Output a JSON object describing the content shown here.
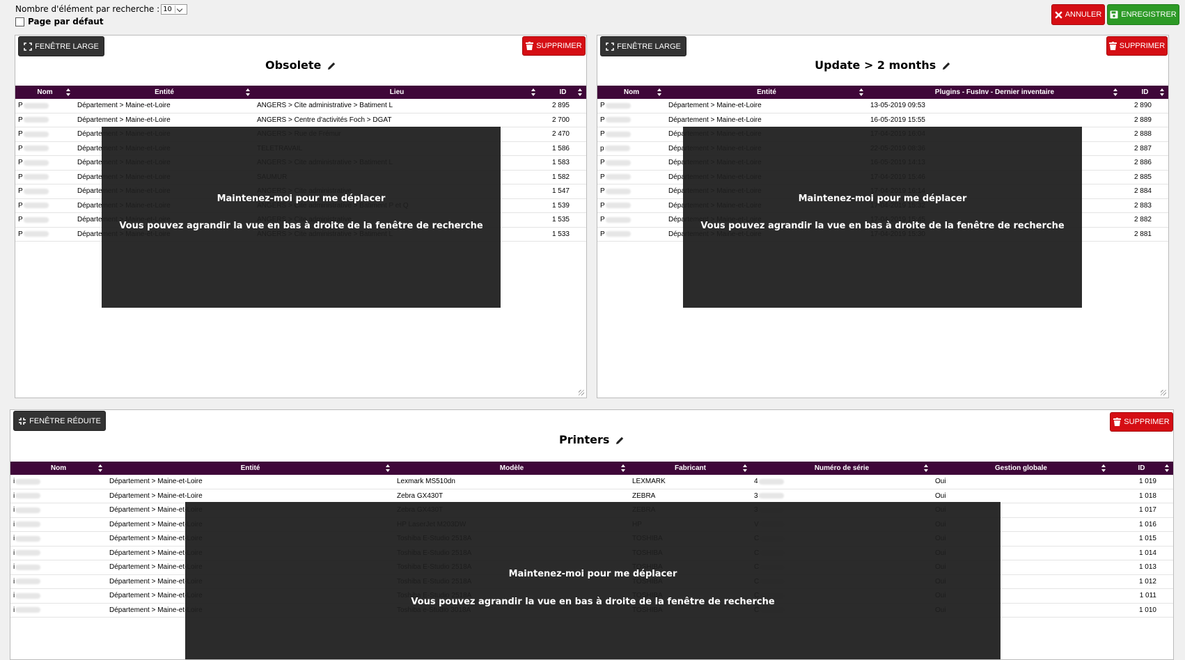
{
  "top": {
    "per_page_label": "Nombre d'élément par recherche :",
    "per_page_value": "10",
    "default_page_label": "Page par défaut",
    "cancel_label": "ANNULER",
    "save_label": "ENREGISTRER"
  },
  "overlay": {
    "line1": "Maintenez-moi pour me déplacer",
    "line2": "Vous pouvez agrandir la vue en bas à droite de la fenêtre de recherche"
  },
  "panels": {
    "obsolete": {
      "title": "Obsolete",
      "wide_label": "FENÊTRE LARGE",
      "delete_label": "SUPPRIMER",
      "columns": [
        "Nom",
        "Entité",
        "Lieu",
        "ID"
      ],
      "rows": [
        [
          "P",
          "Département > Maine-et-Loire",
          "ANGERS > Cite administrative > Batiment L",
          "2 895"
        ],
        [
          "P",
          "Département > Maine-et-Loire",
          "ANGERS > Centre d'activités Foch > DGAT",
          "2 700"
        ],
        [
          "P",
          "Département > Maine-et-Loire",
          "ANGERS > Rue de Frémur",
          "2 470"
        ],
        [
          "P",
          "Département > Maine-et-Loire",
          "TELETRAVAIL",
          "1 586"
        ],
        [
          "P",
          "Département > Maine-et-Loire",
          "ANGERS > Cite administrative > Batiment L",
          "1 583"
        ],
        [
          "P",
          "Département > Maine-et-Loire",
          "SAUMUR",
          "1 582"
        ],
        [
          "P",
          "Département > Maine-et-Loire",
          "ANGERS > Cite administrative",
          "1 547"
        ],
        [
          "P",
          "Département > Maine-et-Loire",
          "ANGERS > Cite administrative > Batiment P et Q",
          "1 539"
        ],
        [
          "P",
          "Département > Maine-et-Loire",
          "ANGERS > Cite administrative",
          "1 535"
        ],
        [
          "P",
          "Département > Maine-et-Loire",
          "ANGERS > Cite administrative > Batiment L",
          "1 533"
        ]
      ]
    },
    "update": {
      "title": "Update > 2 months",
      "wide_label": "FENÊTRE LARGE",
      "delete_label": "SUPPRIMER",
      "columns": [
        "Nom",
        "Entité",
        "Plugins - FusInv - Dernier inventaire",
        "ID"
      ],
      "rows": [
        [
          "P",
          "Département > Maine-et-Loire",
          "13-05-2019 09:53",
          "2 890"
        ],
        [
          "P",
          "Département > Maine-et-Loire",
          "16-05-2019 15:55",
          "2 889"
        ],
        [
          "P",
          "Département > Maine-et-Loire",
          "17-04-2019 16:04",
          "2 888"
        ],
        [
          "p",
          "Département > Maine-et-Loire",
          "22-05-2019 08:36",
          "2 887"
        ],
        [
          "P",
          "Département > Maine-et-Loire",
          "16-05-2019 14:13",
          "2 886"
        ],
        [
          "P",
          "Département > Maine-et-Loire",
          "17-04-2019 15:46",
          "2 885"
        ],
        [
          "P",
          "Département > Maine-et-Loire",
          "17-04-2019 16:14",
          "2 884"
        ],
        [
          "P",
          "Département > Maine-et-Loire",
          "17-04-2019 15:32",
          "2 883"
        ],
        [
          "P",
          "Département > Maine-et-Loire",
          "17-04-2019 15:45",
          "2 882"
        ],
        [
          "P",
          "Département > Maine-et-Loire",
          "17-04-2019 15:30",
          "2 881"
        ]
      ]
    },
    "printers": {
      "title": "Printers",
      "reduce_label": "FENÊTRE RÉDUITE",
      "delete_label": "SUPPRIMER",
      "columns": [
        "Nom",
        "Entité",
        "Modèle",
        "Fabricant",
        "Numéro de série",
        "Gestion globale",
        "ID"
      ],
      "rows": [
        [
          "i",
          "Département > Maine-et-Loire",
          "Lexmark MS510dn",
          "LEXMARK",
          "4",
          "Oui",
          "1 019"
        ],
        [
          "i",
          "Département > Maine-et-Loire",
          "Zebra GX430T",
          "ZEBRA",
          "3",
          "Oui",
          "1 018"
        ],
        [
          "i",
          "Département > Maine-et-Loire",
          "Zebra GX430T",
          "ZEBRA",
          "3",
          "Oui",
          "1 017"
        ],
        [
          "i",
          "Département > Maine-et-Loire",
          "HP LaserJet M203DW",
          "HP",
          "V",
          "Oui",
          "1 016"
        ],
        [
          "i",
          "Département > Maine-et-Loire",
          "Toshiba E-Studio 2518A",
          "TOSHIBA",
          "C",
          "Oui",
          "1 015"
        ],
        [
          "i",
          "Département > Maine-et-Loire",
          "Toshiba E-Studio 2518A",
          "TOSHIBA",
          "C",
          "Oui",
          "1 014"
        ],
        [
          "i",
          "Département > Maine-et-Loire",
          "Toshiba E-Studio 2518A",
          "TOSHIBA",
          "C",
          "Oui",
          "1 013"
        ],
        [
          "i",
          "Département > Maine-et-Loire",
          "Toshiba E-Studio 2518A",
          "TOSHIBA",
          "C",
          "Oui",
          "1 012"
        ],
        [
          "i",
          "Département > Maine-et-Loire",
          "Toshiba E-Studio 2518A",
          "TOSHIBA",
          "C",
          "Oui",
          "1 011"
        ],
        [
          "i",
          "Département > Maine-et-Loire",
          "Toshiba e-Studio 3018A",
          "TOSHIBA",
          "C",
          "Oui",
          "1 010"
        ]
      ]
    }
  }
}
